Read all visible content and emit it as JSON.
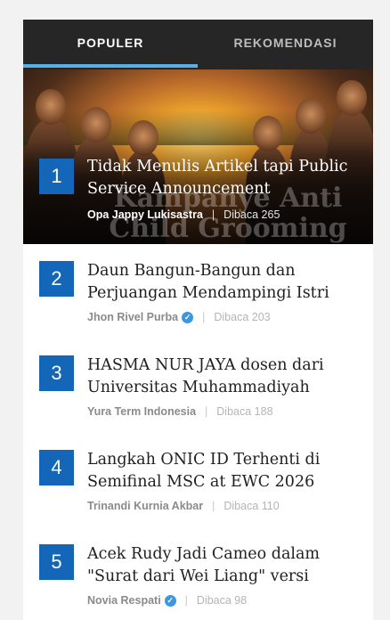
{
  "tabs": [
    {
      "label": "POPULER"
    },
    {
      "label": "REKOMENDASI"
    }
  ],
  "hero": {
    "overlay_text": "Kampanye Anti\nChild Grooming"
  },
  "items": [
    {
      "rank": "1",
      "title": "Tidak Menulis Artikel tapi Public Service Announcement",
      "author": "Opa Jappy Lukisastra",
      "verified": false,
      "separator": "|",
      "reads": "Dibaca 265"
    },
    {
      "rank": "2",
      "title": "Daun Bangun-Bangun dan Perjuangan Mendampingi Istri",
      "author": "Jhon Rivel Purba",
      "verified": true,
      "separator": "|",
      "reads": "Dibaca 203"
    },
    {
      "rank": "3",
      "title": "HASMA NUR JAYA dosen dari Universitas Muhammadiyah",
      "author": "Yura Term Indonesia",
      "verified": false,
      "separator": "|",
      "reads": "Dibaca 188"
    },
    {
      "rank": "4",
      "title": "Langkah ONIC ID Terhenti di Semifinal MSC at EWC 2026",
      "author": "Trinandi Kurnia Akbar",
      "verified": false,
      "separator": "|",
      "reads": "Dibaca 110"
    },
    {
      "rank": "5",
      "title": "Acek Rudy Jadi Cameo dalam \"Surat dari Wei Liang\" versi",
      "author": "Novia Respati",
      "verified": true,
      "separator": "|",
      "reads": "Dibaca 98"
    }
  ],
  "colors": {
    "tab_bar": "#262626",
    "tab_underline": "#5aaee6",
    "rank_box": "#1466b8",
    "verified_badge": "#3d97e0"
  },
  "icons": {
    "verified": "verified-check-icon"
  }
}
